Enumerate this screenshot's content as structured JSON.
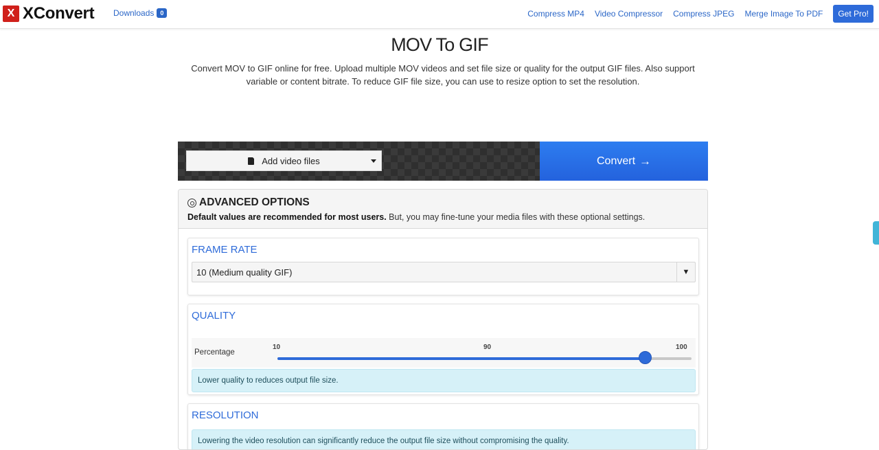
{
  "nav": {
    "brand_logo": "X",
    "brand_name": "XConvert",
    "downloads_label": "Downloads",
    "downloads_count": "0",
    "links": [
      "Compress MP4",
      "Video Compressor",
      "Compress JPEG",
      "Merge Image To PDF"
    ],
    "cta": "Get Pro!"
  },
  "hero": {
    "title": "MOV To GIF",
    "description": "Convert MOV to GIF online for free. Upload multiple MOV videos and set file size or quality for the output GIF files. Also support variable or content bitrate. To reduce GIF file size, you can use to resize option to set the resolution."
  },
  "actions": {
    "add_files": "Add video files",
    "convert": "Convert",
    "convert_arrow": "→"
  },
  "advanced": {
    "title": "ADVANCED OPTIONS",
    "subtitle_bold": "Default values are recommended for most users.",
    "subtitle_rest": " But, you may fine-tune your media files with these optional settings."
  },
  "frame_rate": {
    "title": "FRAME RATE",
    "selected": "10 (Medium quality GIF)",
    "arrow": "▼"
  },
  "quality": {
    "title": "QUALITY",
    "label": "Percentage",
    "min": 10,
    "max": 100,
    "value": 90,
    "tick_min": "10",
    "tick_mid": "90",
    "tick_max": "100",
    "info": "Lower quality to reduces output file size."
  },
  "resolution": {
    "title": "RESOLUTION",
    "info": "Lowering the video resolution can significantly reduce the output file size without compromising the quality."
  },
  "colors": {
    "accent": "#2e6bd9",
    "brand_red": "#d0201b",
    "info_bg": "#d6f1f8"
  }
}
